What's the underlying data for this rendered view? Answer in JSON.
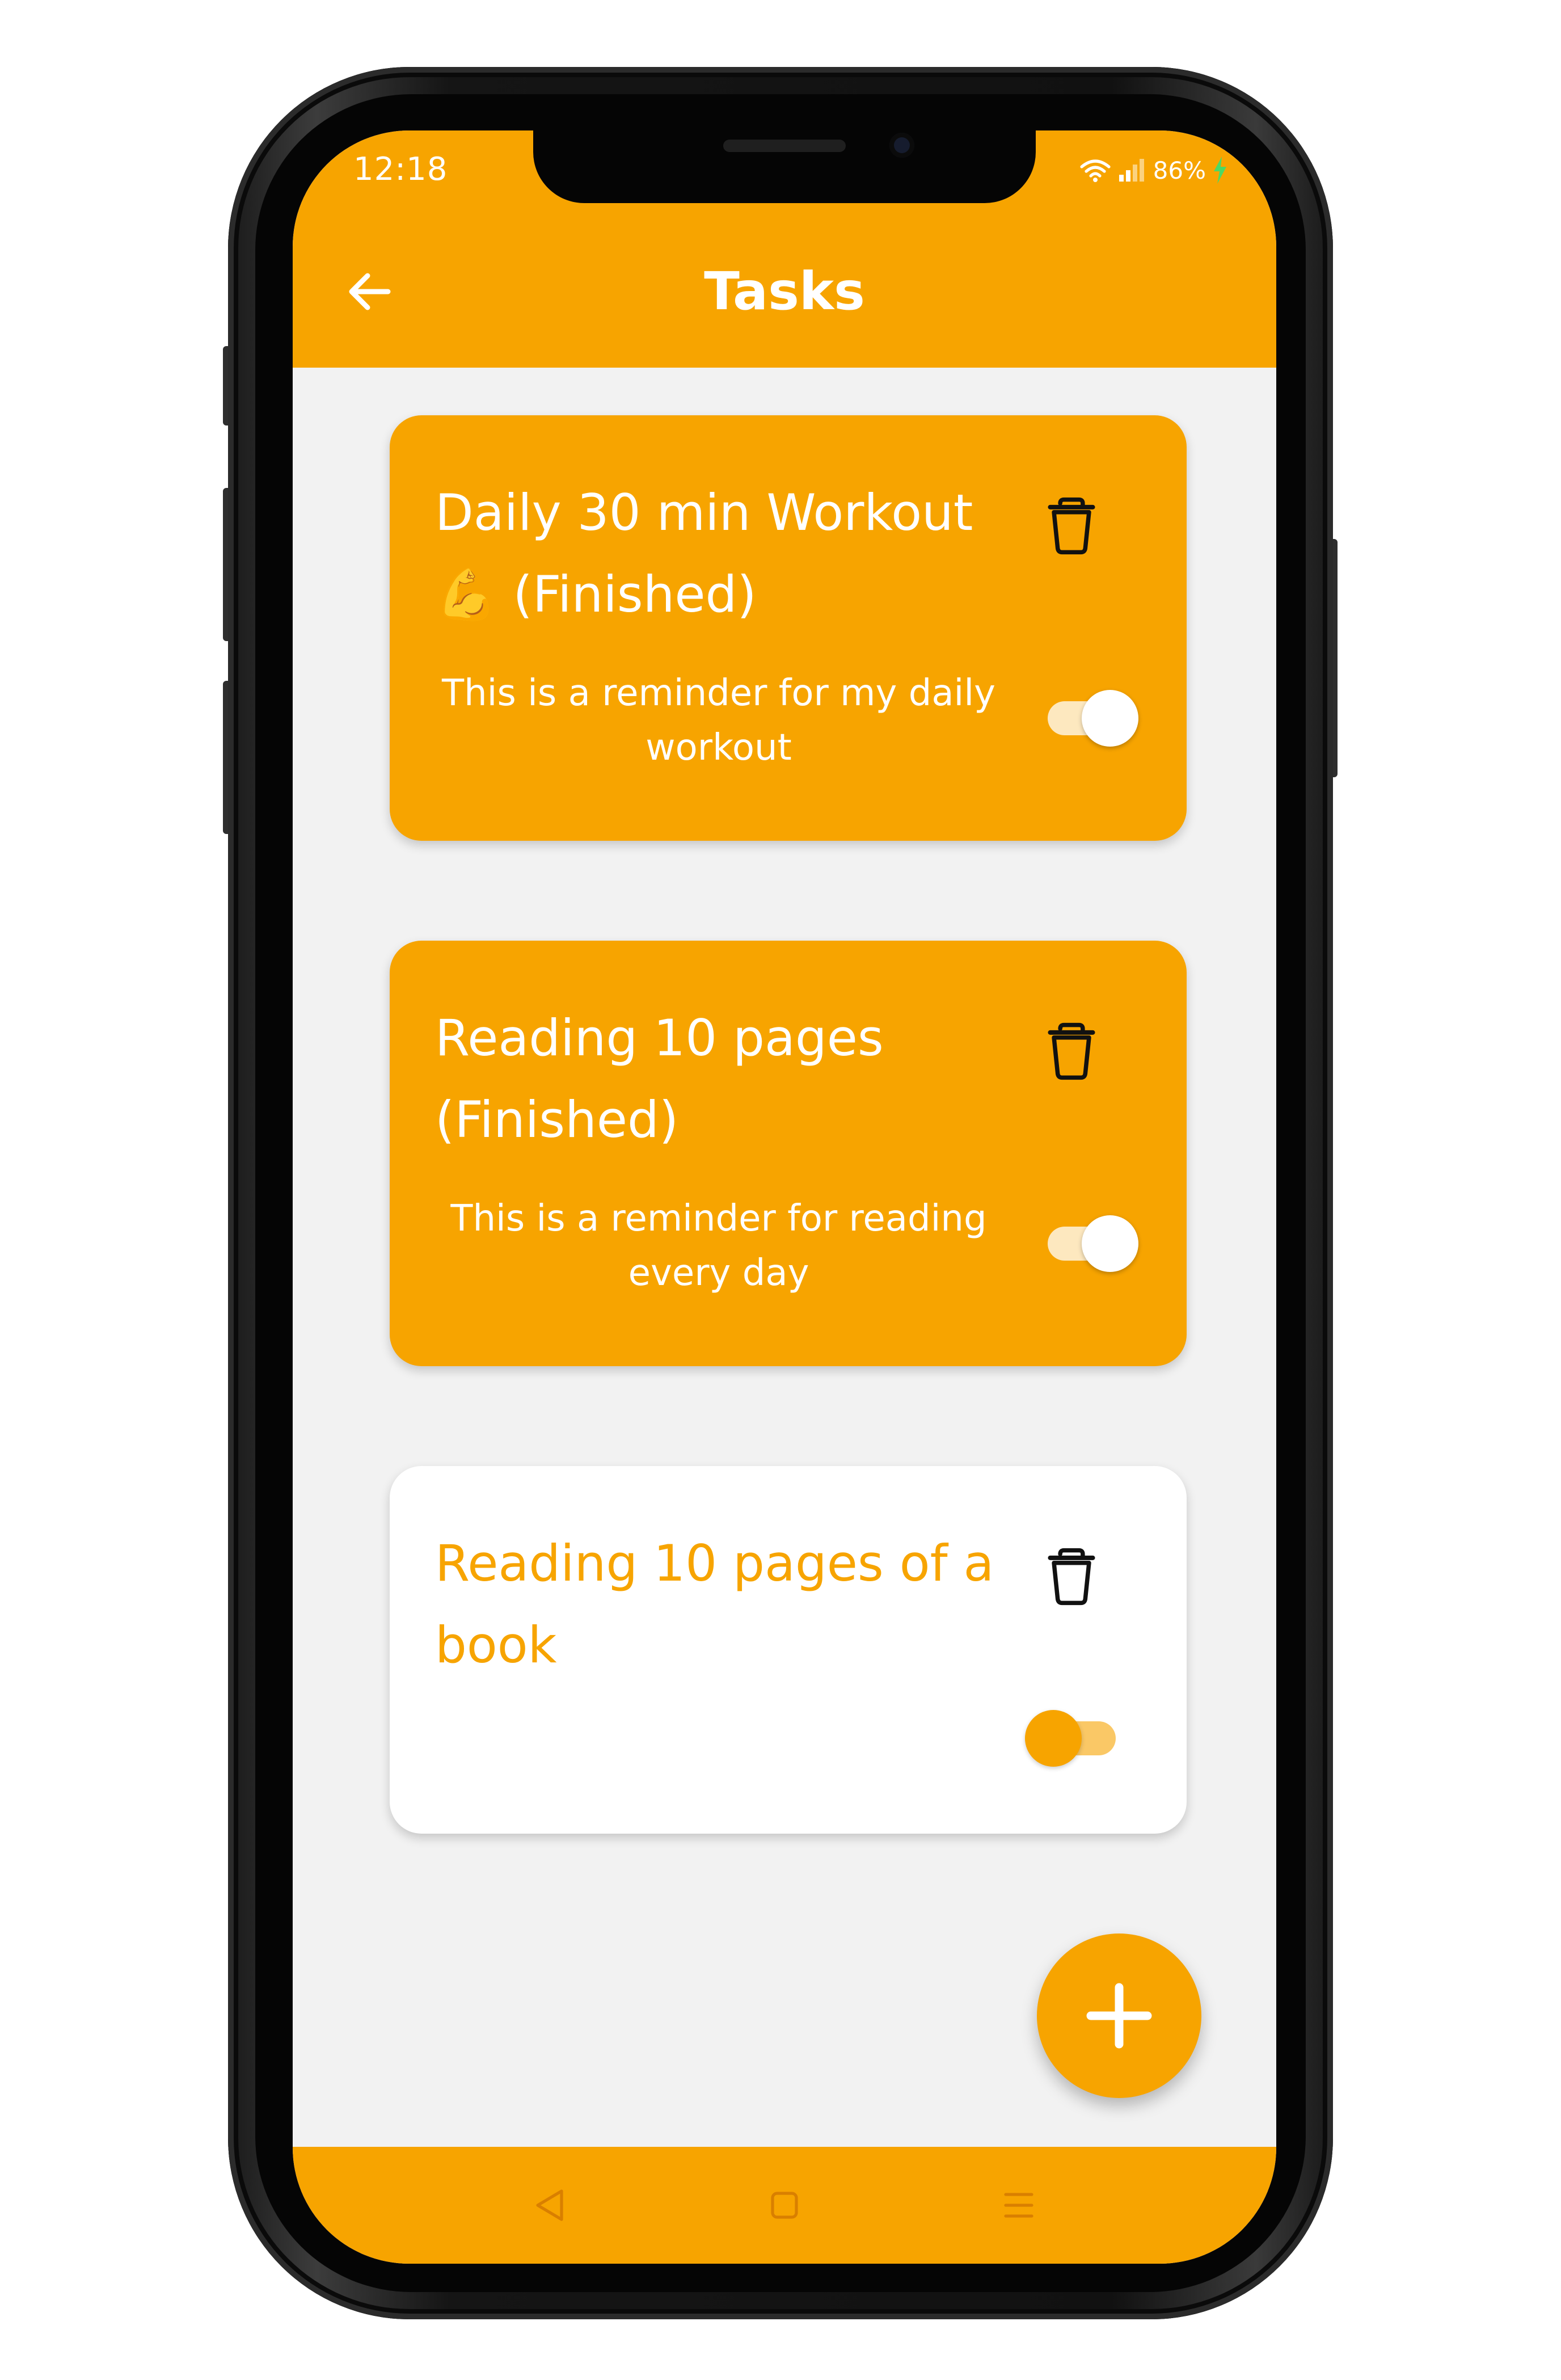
{
  "status_bar": {
    "time": "12:18",
    "battery": "86%",
    "icons": [
      "wifi-icon",
      "signal-icon",
      "charging-icon"
    ]
  },
  "app_bar": {
    "title": "Tasks",
    "back_icon": "arrow-left-icon"
  },
  "tasks": [
    {
      "title": "Daily 30 min Workout 💪 (Finished)",
      "description": "This is a reminder for my daily workout",
      "finished": true,
      "toggle_on": true
    },
    {
      "title": "Reading 10 pages (Finished)",
      "description": "This is a reminder for reading every day",
      "finished": true,
      "toggle_on": true
    },
    {
      "title": "Reading 10 pages of a book",
      "description": "",
      "finished": false,
      "toggle_on": false
    }
  ],
  "fab": {
    "icon": "plus-icon"
  },
  "nav_bar": {
    "icons": [
      "back-triangle-icon",
      "home-square-icon",
      "menu-lines-icon"
    ]
  },
  "colors": {
    "accent": "#f7a400",
    "background": "#f2f2f2",
    "card_open": "#ffffff",
    "text_on_accent": "#ffffff"
  }
}
